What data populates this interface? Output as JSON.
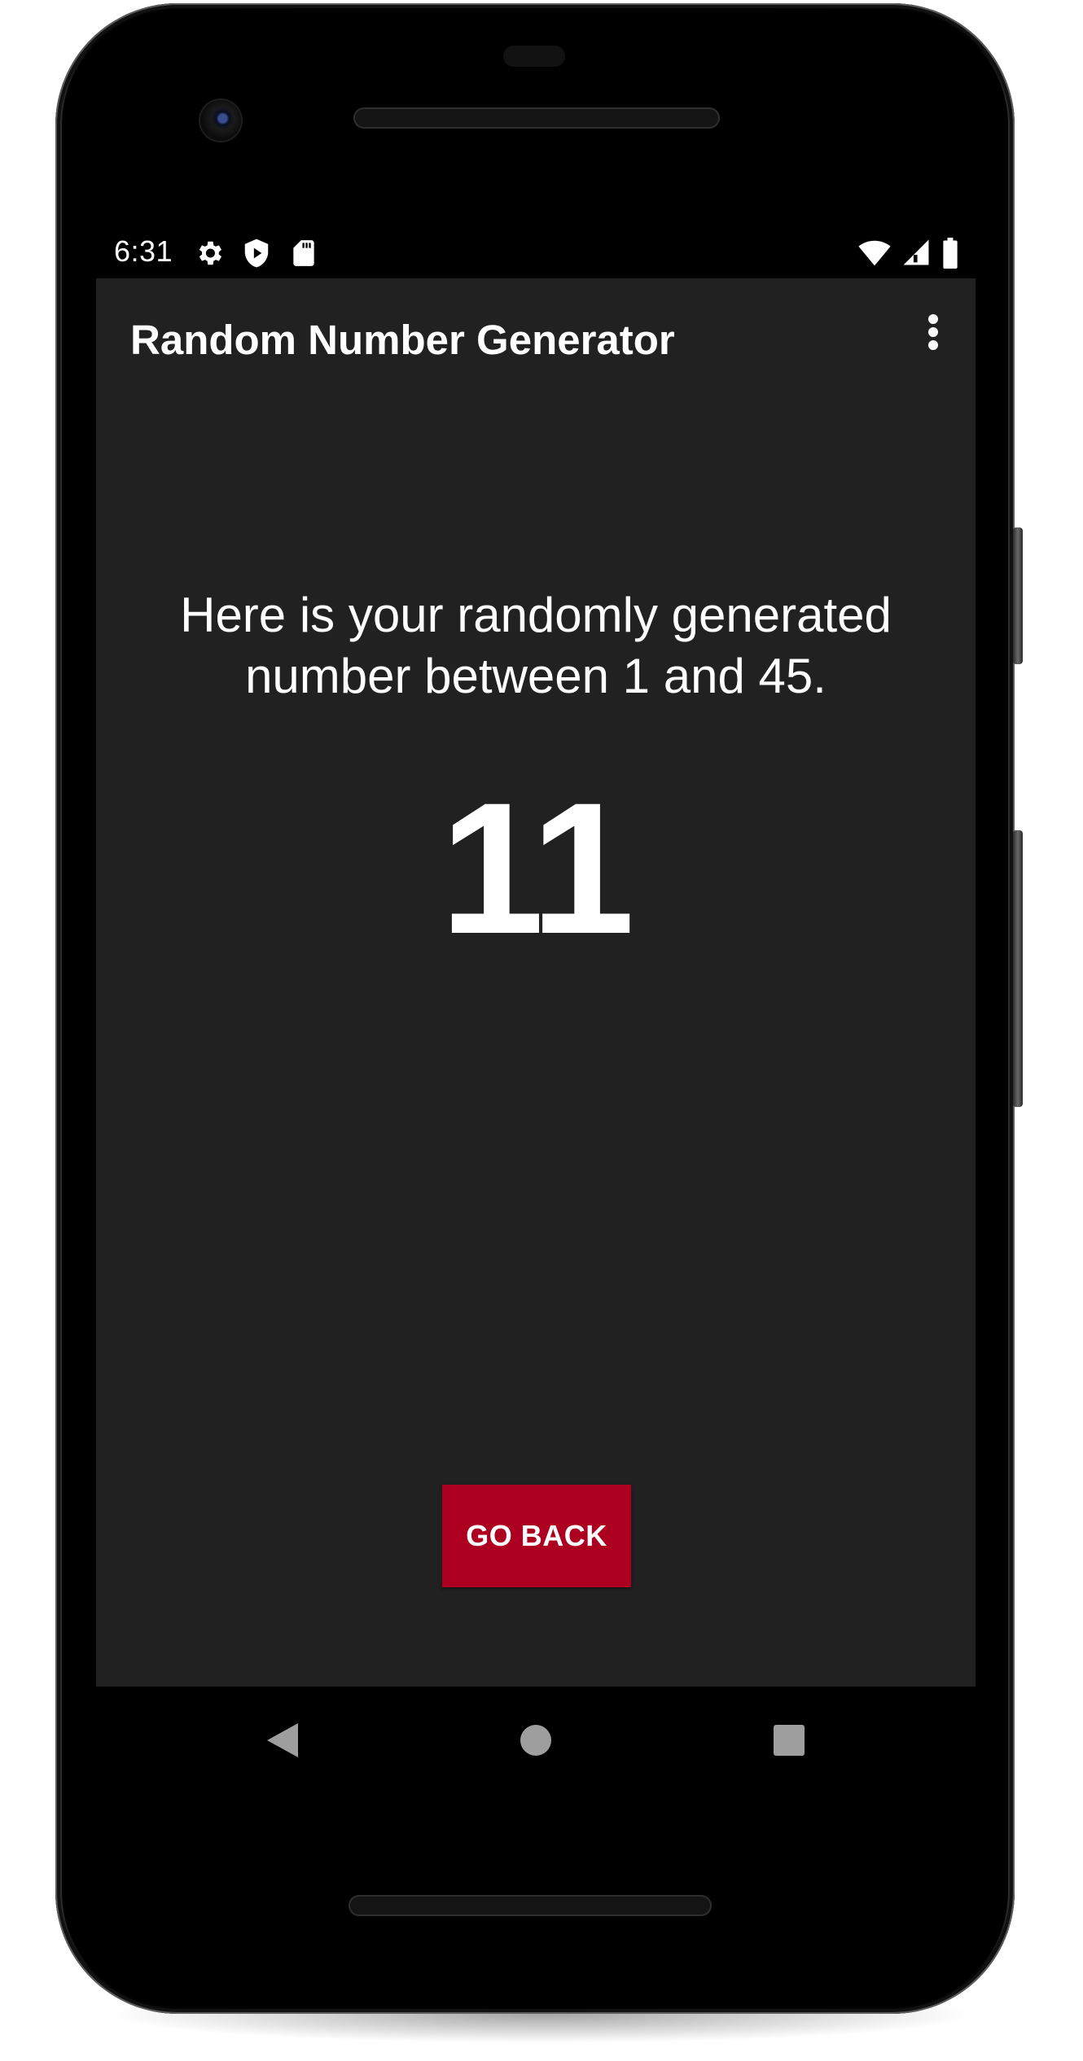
{
  "status_bar": {
    "time": "6:31",
    "left_icons": [
      "settings-gear-icon",
      "shield-icon",
      "sd-card-icon"
    ],
    "right_icons": [
      "wifi-icon",
      "cell-signal-icon",
      "battery-icon"
    ]
  },
  "app_bar": {
    "title": "Random Number Generator",
    "overflow_icon": "more-vert-icon"
  },
  "main": {
    "message": "Here is your randomly generated number between 1 and 45.",
    "result": "11",
    "button_label": "GO BACK"
  },
  "nav_bar": {
    "icons": [
      "back-triangle-icon",
      "home-circle-icon",
      "recents-square-icon"
    ]
  },
  "colors": {
    "screen_background": "#212121",
    "button_background": "#ad0021",
    "text": "#ffffff"
  }
}
